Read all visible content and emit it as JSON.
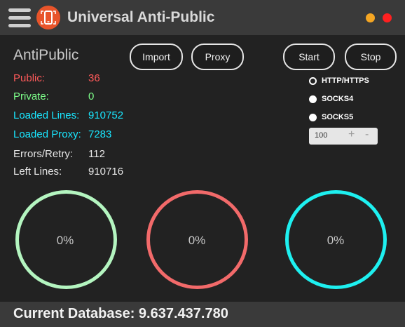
{
  "window": {
    "title": "Universal Anti-Public",
    "app_icon": "phone-icon",
    "controls": {
      "minimize_color": "#f5a623",
      "close_color": "#ff2020"
    }
  },
  "brand": "AntiPublic",
  "toolbar": {
    "import_label": "Import",
    "proxy_label": "Proxy",
    "start_label": "Start",
    "stop_label": "Stop"
  },
  "stats": [
    {
      "label": "Public:",
      "value": "36",
      "color": "#ff5a5a"
    },
    {
      "label": "Private:",
      "value": "0",
      "color": "#7dff8a"
    },
    {
      "label": "Loaded Lines:",
      "value": "910752",
      "color": "#19e6ff"
    },
    {
      "label": "Loaded Proxy:",
      "value": "7283",
      "color": "#19e6ff"
    },
    {
      "label": "Errors/Retry:",
      "value": "112",
      "color": "#e6e6e6"
    },
    {
      "label": "Left Lines:",
      "value": "910716",
      "color": "#e6e6e6"
    }
  ],
  "proxy_types": {
    "options": [
      "HTTP/HTTPS",
      "SOCKS4",
      "SOCKS5"
    ],
    "selected": "HTTP/HTTPS"
  },
  "threads": {
    "value": "100",
    "plus": "+",
    "minus": "-"
  },
  "progress": [
    {
      "name": "public",
      "value": "0%",
      "color": "#b4f5c0"
    },
    {
      "name": "private",
      "value": "0%",
      "color": "#f26a6a"
    },
    {
      "name": "loaded",
      "value": "0%",
      "color": "#1ef0f0"
    }
  ],
  "footer": {
    "text": "Current Database: 9.637.437.780"
  }
}
